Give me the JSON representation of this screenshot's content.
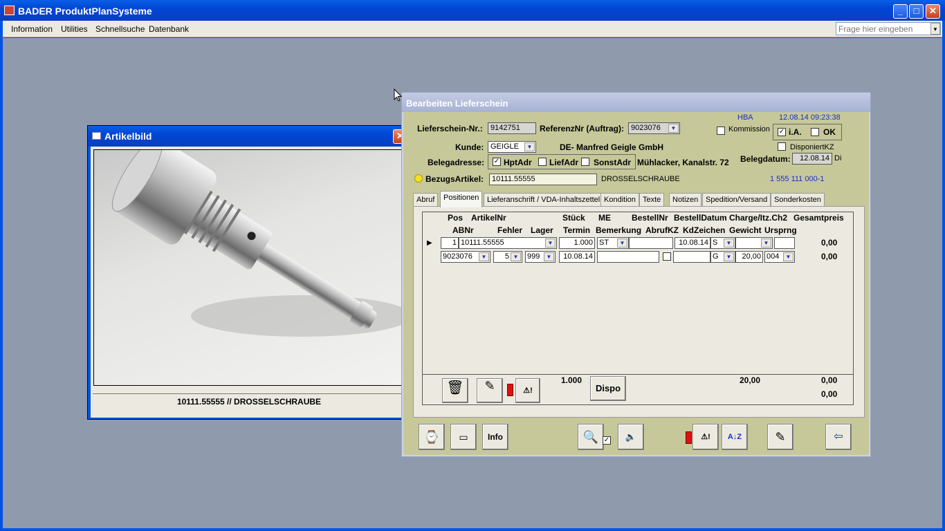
{
  "app": {
    "title": "BADER ProduktPlanSysteme"
  },
  "menu": {
    "items": [
      "Information",
      "Utilities",
      "Schnellsuche",
      "Datenbank"
    ],
    "ask": "Frage hier eingeben"
  },
  "artikelbild": {
    "title": "Artikelbild",
    "caption": "10111.55555  //  DROSSELSCHRAUBE"
  },
  "ls": {
    "title": "Bearbeiten Lieferschein",
    "user": "HBA",
    "timestamp": "12.08.14 09:23:38",
    "lsnr_label": "Lieferschein-Nr.:",
    "lsnr": "9142751",
    "ref_label": "ReferenzNr (Auftrag):",
    "ref": "9023076",
    "kommission": "Kommission",
    "ia": "i.A.",
    "ok": "OK",
    "kunde_label": "Kunde:",
    "kunde": "GEIGLE",
    "kunde_name": "DE-  Manfred Geigle GmbH",
    "disponiert": "DisponiertKZ",
    "beleg_label": "Belegadresse:",
    "hptadr": "HptAdr",
    "liefadr": "LiefAdr",
    "sonstadr": "SonstAdr",
    "adresse": "Mühlacker, Kanalstr. 72",
    "belegdatum_label": "Belegdatum:",
    "belegdatum": "12.08.14",
    "weekday": "Di",
    "bezug_label": "BezugsArtikel:",
    "bezug": "10111.55555",
    "bezug_name": "DROSSELSCHRAUBE",
    "bezug_code": "1 555 111 000-1",
    "tabs": [
      "Abruf",
      "Positionen",
      "Lieferanschrift / VDA-Inhaltszettel",
      "Kondition",
      "Texte",
      "Notizen",
      "Spedition/Versand",
      "Sonderkosten"
    ],
    "head1": [
      "Pos",
      "ArtikelNr",
      "Stück",
      "ME",
      "BestellNr",
      "BestellDatum",
      "Charge/Itz.Ch2",
      "Gesamtpreis"
    ],
    "head2": [
      "ABNr",
      "Fehler",
      "Lager",
      "Termin",
      "Bemerkung",
      "AbrufKZ",
      "KdZeichen",
      "Gewicht",
      "Ursprng"
    ],
    "row1": {
      "pos": "1",
      "artikel": "10111.55555",
      "stueck": "1.000",
      "me": "ST",
      "bestelldatum": "10.08.14",
      "s": "S",
      "preis": "0,00"
    },
    "row2": {
      "abnr": "9023076",
      "fehler": "5",
      "lager": "999",
      "termin": "10.08.14",
      "kz": "G",
      "gewicht": "20,00",
      "ursprng": "004",
      "preis": "0,00"
    },
    "footer": {
      "stueck": "1.000",
      "dispo": "Dispo",
      "gewicht": "20,00",
      "preis1": "0,00",
      "preis2": "0,00"
    },
    "toolbar": {
      "info": "Info"
    }
  }
}
